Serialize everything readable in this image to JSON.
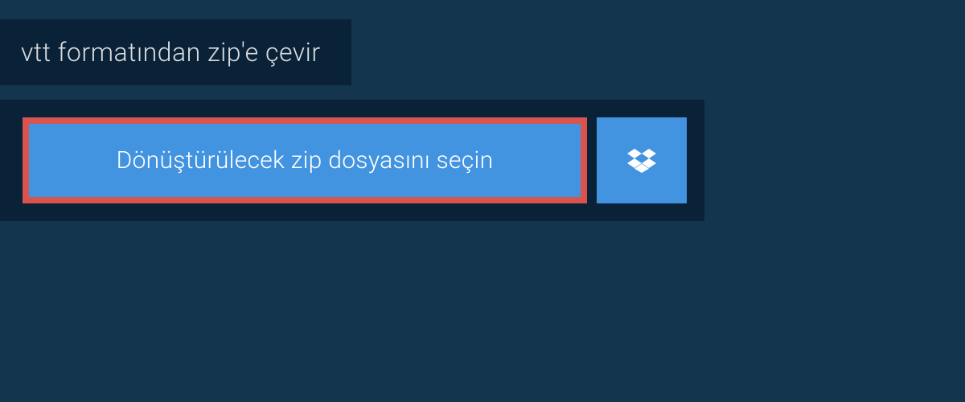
{
  "header": {
    "title": "vtt formatından zip'e çevir"
  },
  "upload": {
    "select_file_label": "Dönüştürülecek zip dosyasını seçin"
  },
  "colors": {
    "page_bg": "#14354e",
    "panel_bg": "#0a2238",
    "button_bg": "#4394e0",
    "highlight_border": "#d9534f",
    "text_light": "#d9dde0",
    "text_white": "#ffffff"
  }
}
